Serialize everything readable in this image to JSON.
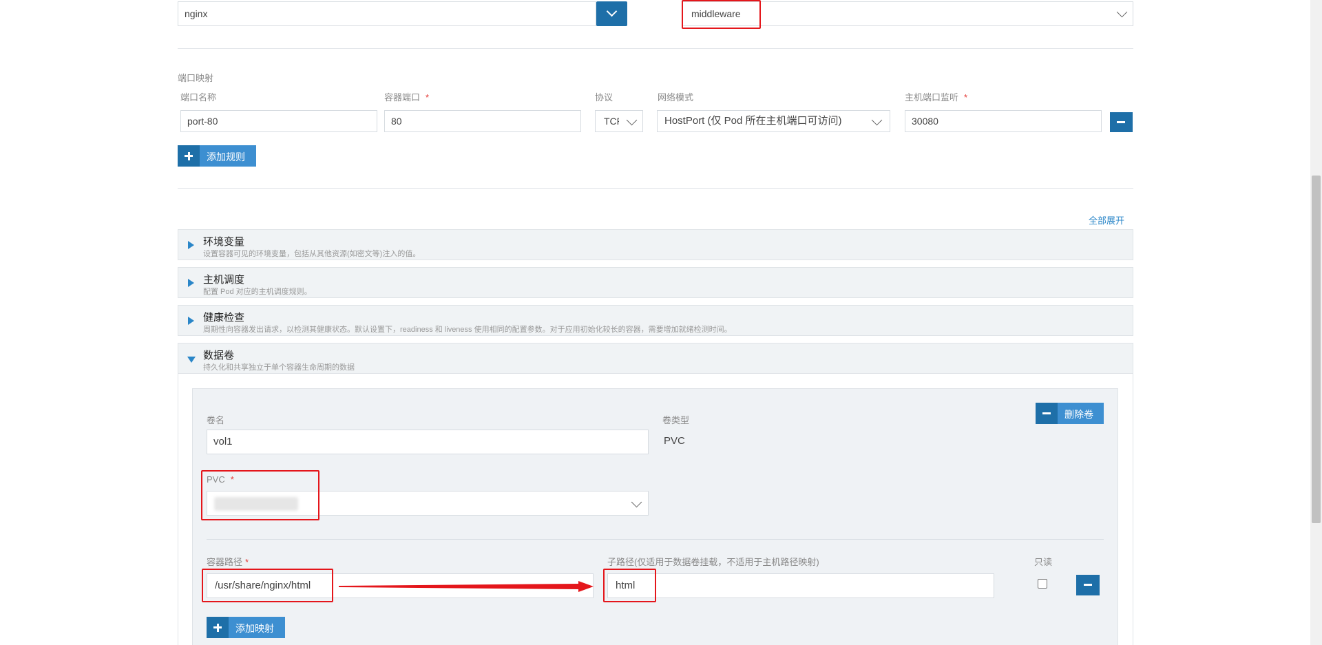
{
  "top": {
    "image_value": "nginx",
    "namespace_value": "middleware"
  },
  "ports": {
    "section_label": "端口映射",
    "col_name": "端口名称",
    "col_container_port": "容器端口",
    "col_protocol": "协议",
    "col_network_mode": "网络模式",
    "col_host_port": "主机端口监听",
    "required_mark": "*",
    "row": {
      "name": "port-80",
      "container_port": "80",
      "protocol": "TCP",
      "network_mode": "HostPort (仅 Pod 所在主机端口可访问)",
      "host_port": "30080"
    },
    "add_rule_label": "添加规则"
  },
  "expand_all_label": "全部展开",
  "panels": [
    {
      "title": "环境变量",
      "desc": "设置容器可见的环境变量，包括从其他资源(如密文等)注入的值。",
      "expanded": false
    },
    {
      "title": "主机调度",
      "desc": "配置 Pod 对应的主机调度规则。",
      "expanded": false
    },
    {
      "title": "健康检查",
      "desc": "周期性向容器发出请求，以检测其健康状态。默认设置下，readiness 和 liveness 使用相同的配置参数。对于应用初始化较长的容器，需要增加就绪检测时间。",
      "expanded": false
    },
    {
      "title": "数据卷",
      "desc": "持久化和共享独立于单个容器生命周期的数据",
      "expanded": true
    }
  ],
  "volume": {
    "name_label": "卷名",
    "name_value": "vol1",
    "type_label": "卷类型",
    "type_value": "PVC",
    "delete_label": "删除卷",
    "pvc_label": "PVC",
    "container_path_label": "容器路径",
    "container_path_value": "/usr/share/nginx/html",
    "subpath_label": "子路径(仅适用于数据卷挂载，不适用于主机路径映射)",
    "subpath_value": "html",
    "readonly_label": "只读",
    "add_mapping_label": "添加映射"
  },
  "colors": {
    "accent": "#1e6fa8",
    "link": "#2a86c8",
    "highlight": "#e4161b",
    "panel_bg": "#f0f3f5"
  }
}
